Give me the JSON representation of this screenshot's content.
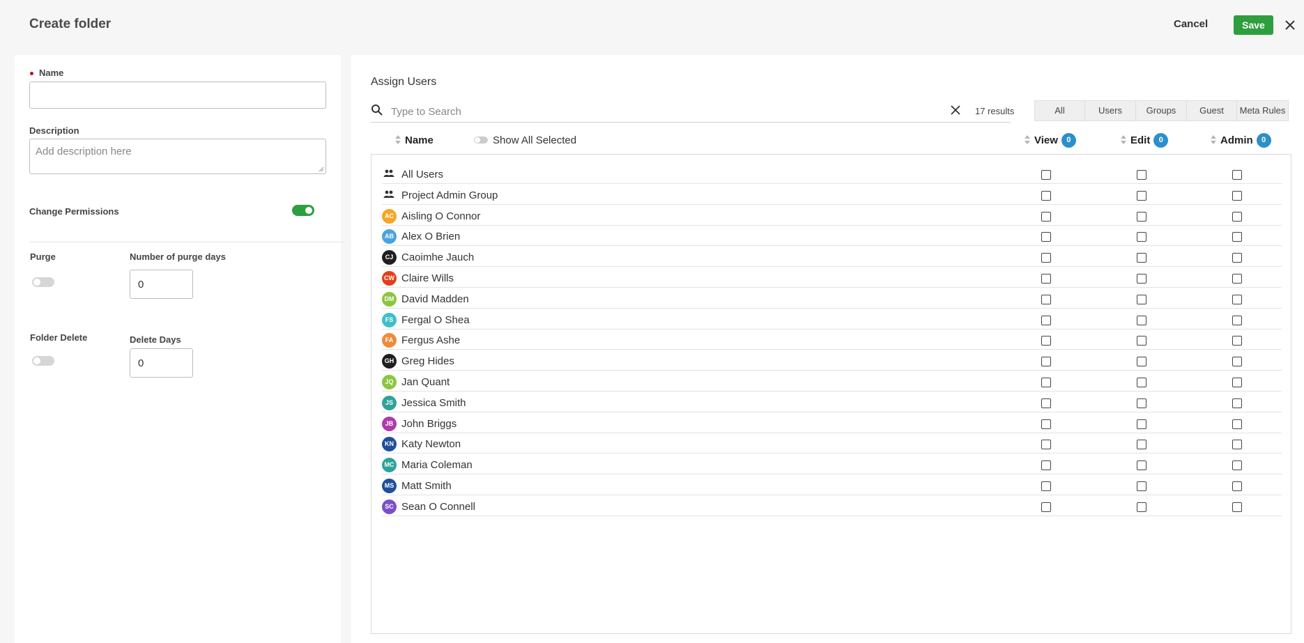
{
  "header": {
    "title": "Create folder",
    "cancel_label": "Cancel",
    "save_label": "Save"
  },
  "form": {
    "name_label": "Name",
    "name_value": "",
    "description_label": "Description",
    "description_placeholder": "Add description here",
    "change_permissions_label": "Change Permissions",
    "change_permissions_on": true,
    "purge_label": "Purge",
    "purge_on": false,
    "purge_days_label": "Number of purge days",
    "purge_days_value": "0",
    "folder_delete_label": "Folder Delete",
    "folder_delete_on": false,
    "delete_days_label": "Delete Days",
    "delete_days_value": "0"
  },
  "assign": {
    "title": "Assign Users",
    "search_placeholder": "Type to Search",
    "results": "17 results",
    "filters": [
      "All",
      "Users",
      "Groups",
      "Guest",
      "Meta Rules"
    ],
    "columns": {
      "name": "Name",
      "show_all": "Show All Selected",
      "view": "View",
      "edit": "Edit",
      "admin": "Admin"
    },
    "counts": {
      "view": "0",
      "edit": "0",
      "admin": "0"
    },
    "rows": [
      {
        "type": "group",
        "name": "All Users"
      },
      {
        "type": "group",
        "name": "Project Admin Group"
      },
      {
        "type": "user",
        "initials": "AC",
        "name": "Aisling O Connor",
        "color": "#f5a623"
      },
      {
        "type": "user",
        "initials": "AB",
        "name": "Alex O Brien",
        "color": "#4aa3df"
      },
      {
        "type": "user",
        "initials": "CJ",
        "name": "Caoimhe Jauch",
        "color": "#1f1f1f"
      },
      {
        "type": "user",
        "initials": "CW",
        "name": "Claire Wills",
        "color": "#e2401c"
      },
      {
        "type": "user",
        "initials": "DM",
        "name": "David Madden",
        "color": "#8cc63f"
      },
      {
        "type": "user",
        "initials": "FS",
        "name": "Fergal O Shea",
        "color": "#3cc0c8"
      },
      {
        "type": "user",
        "initials": "FA",
        "name": "Fergus Ashe",
        "color": "#f08a3c"
      },
      {
        "type": "user",
        "initials": "GH",
        "name": "Greg Hides",
        "color": "#1f1f1f"
      },
      {
        "type": "user",
        "initials": "JQ",
        "name": "Jan Quant",
        "color": "#8cc63f"
      },
      {
        "type": "user",
        "initials": "JS",
        "name": "Jessica Smith",
        "color": "#2fa39a"
      },
      {
        "type": "user",
        "initials": "JB",
        "name": "John Briggs",
        "color": "#b03aa8"
      },
      {
        "type": "user",
        "initials": "KN",
        "name": "Katy Newton",
        "color": "#1e4f9c"
      },
      {
        "type": "user",
        "initials": "MC",
        "name": "Maria Coleman",
        "color": "#2fa39a"
      },
      {
        "type": "user",
        "initials": "MS",
        "name": "Matt Smith",
        "color": "#1e4f9c"
      },
      {
        "type": "user",
        "initials": "SC",
        "name": "Sean O Connell",
        "color": "#7b4fc9"
      }
    ]
  }
}
